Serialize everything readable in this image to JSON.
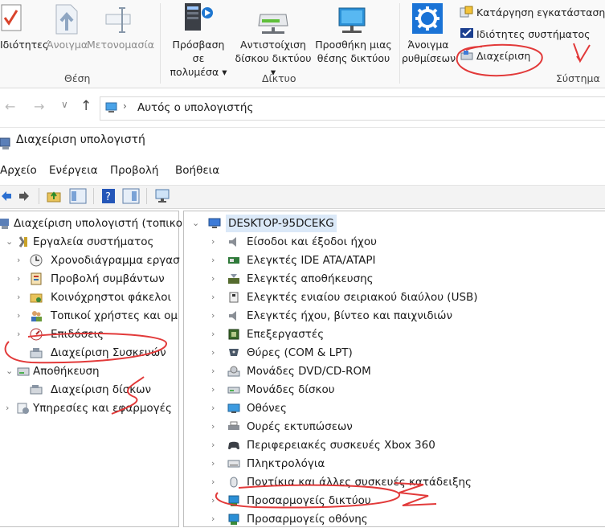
{
  "ribbon": {
    "properties": "Ιδιότητες",
    "open": "Άνοιγμα",
    "rename": "Μετονομασία",
    "location_group": "Θέση",
    "media_access_line1": "Πρόσβαση σε",
    "media_access_line2": "πολυμέσα",
    "map_drive_line1": "Αντιστοίχιση",
    "map_drive_line2": "δίσκου δικτύου",
    "add_location_line1": "Προσθήκη μιας",
    "add_location_line2": "θέσης δικτύου",
    "network_group": "Δίκτυο",
    "open_settings_line1": "Άνοιγμα",
    "open_settings_line2": "ρυθμίσεων",
    "uninstall": "Κατάργηση εγκατάστασης ή",
    "system_properties": "Ιδιότητες συστήματος",
    "manage": "Διαχείριση",
    "system_group": "Σύστημα"
  },
  "address": {
    "path": "Αυτός ο υπολογιστής"
  },
  "mmc": {
    "title": "Διαχείριση υπολογιστή",
    "menu": [
      "Αρχείο",
      "Ενέργεια",
      "Προβολή",
      "Βοήθεια"
    ]
  },
  "left_tree": [
    {
      "label": "Διαχείριση υπολογιστή (τοπικο",
      "icon": "computer-management-icon"
    },
    {
      "label": "Εργαλεία συστήματος",
      "icon": "tools-icon"
    },
    {
      "label": "Χρονοδιάγραμμα εργασ",
      "icon": "clock-icon"
    },
    {
      "label": "Προβολή συμβάντων",
      "icon": "event-viewer-icon"
    },
    {
      "label": "Κοινόχρηστοι φάκελοι",
      "icon": "shared-folder-icon"
    },
    {
      "label": "Τοπικοί χρήστες και ομ",
      "icon": "users-icon"
    },
    {
      "label": "Επιδόσεις",
      "icon": "performance-icon"
    },
    {
      "label": "Διαχείριση Συσκευών",
      "icon": "device-manager-icon"
    },
    {
      "label": "Αποθήκευση",
      "icon": "storage-icon"
    },
    {
      "label": "Διαχείριση δίσκων",
      "icon": "disk-management-icon"
    },
    {
      "label": "Υπηρεσίες και εφαρμογές",
      "icon": "services-icon"
    }
  ],
  "right_tree": {
    "root": "DESKTOP-95DCEKG",
    "items": [
      {
        "label": "Είσοδοι και έξοδοι ήχου",
        "icon": "speaker-icon"
      },
      {
        "label": "Ελεγκτές IDE ATA/ATAPI",
        "icon": "ide-controller-icon"
      },
      {
        "label": "Ελεγκτές αποθήκευσης",
        "icon": "storage-controller-icon"
      },
      {
        "label": "Ελεγκτές ενιαίου σειριακού διαύλου (USB)",
        "icon": "usb-icon"
      },
      {
        "label": "Ελεγκτές ήχου, βίντεο και παιχνιδιών",
        "icon": "sound-icon"
      },
      {
        "label": "Επεξεργαστές",
        "icon": "processor-icon"
      },
      {
        "label": "Θύρες (COM & LPT)",
        "icon": "port-icon"
      },
      {
        "label": "Μονάδες DVD/CD-ROM",
        "icon": "dvd-icon"
      },
      {
        "label": "Μονάδες δίσκου",
        "icon": "disk-drive-icon"
      },
      {
        "label": "Οθόνες",
        "icon": "monitor-icon"
      },
      {
        "label": "Ουρές εκτυπώσεων",
        "icon": "printer-icon"
      },
      {
        "label": "Περιφερειακές συσκευές Xbox 360",
        "icon": "gamepad-icon"
      },
      {
        "label": "Πληκτρολόγια",
        "icon": "keyboard-icon"
      },
      {
        "label": "Ποντίκια και άλλες συσκευές κατάδειξης",
        "icon": "mouse-icon"
      },
      {
        "label": "Προσαρμογείς δικτύου",
        "icon": "network-adapter-icon"
      },
      {
        "label": "Προσαρμογείς οθόνης",
        "icon": "display-adapter-icon"
      }
    ]
  }
}
